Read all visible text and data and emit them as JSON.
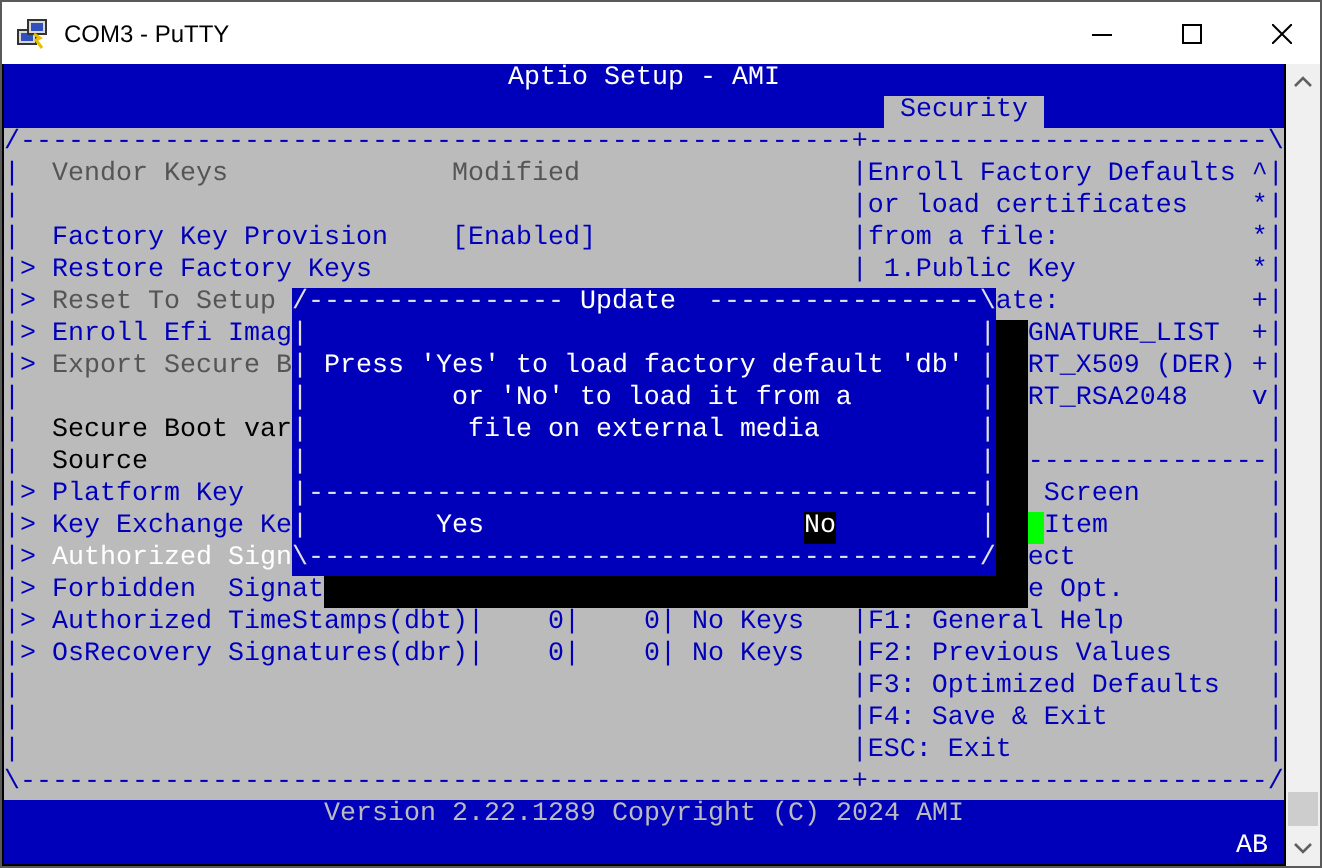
{
  "window": {
    "title": "COM3 - PuTTY"
  },
  "terminal": {
    "lines": [
      {
        "kind": "header",
        "runs": [
          {
            "kind": "title",
            "text": "Aptio Setup - AMI"
          }
        ]
      },
      {
        "kind": "tabs",
        "runs": [
          {
            "kind": "tab",
            "text": "Security",
            "selected": true
          }
        ]
      },
      {
        "kind": "body",
        "runs": [
          {
            "kind": "frame",
            "text": "/----------------------------------------------------+-------------------------\\"
          }
        ]
      },
      {
        "kind": "body",
        "runs": [
          {
            "kind": "frame",
            "text": "|"
          },
          {
            "kind": "muted",
            "text": "  Vendor Keys"
          },
          {
            "kind": "muted",
            "text": "              Modified"
          },
          {
            "kind": "frame",
            "text": "                 |"
          },
          {
            "kind": "label",
            "text": "Enroll Factory Defaults"
          },
          {
            "kind": "frame",
            "text": " ^|"
          }
        ]
      },
      {
        "kind": "body",
        "runs": [
          {
            "kind": "frame",
            "text": "|                                                    |"
          },
          {
            "kind": "label",
            "text": "or load certificates"
          },
          {
            "kind": "frame",
            "text": "    *|"
          }
        ]
      },
      {
        "kind": "body",
        "runs": [
          {
            "kind": "frame",
            "text": "|"
          },
          {
            "kind": "label",
            "text": "  Factory Key Provision"
          },
          {
            "kind": "label",
            "text": "    [Enabled]"
          },
          {
            "kind": "frame",
            "text": "                |"
          },
          {
            "kind": "label",
            "text": "from a file:"
          },
          {
            "kind": "frame",
            "text": "            *|"
          }
        ]
      },
      {
        "kind": "body",
        "runs": [
          {
            "kind": "frame",
            "text": "|>"
          },
          {
            "kind": "label",
            "text": " Restore Factory Keys"
          },
          {
            "kind": "frame",
            "text": "                              |"
          },
          {
            "kind": "label",
            "text": " 1.Public Key"
          },
          {
            "kind": "frame",
            "text": "           *|"
          }
        ]
      },
      {
        "kind": "body",
        "runs": [
          {
            "kind": "frame",
            "text": "|>"
          },
          {
            "kind": "muted",
            "text": " Reset To Setup "
          },
          {
            "kind": "dframe",
            "text": "/---------------- "
          },
          {
            "kind": "dtitle",
            "text": "Update"
          },
          {
            "kind": "dframe",
            "text": "  -----------------\\"
          },
          {
            "kind": "label",
            "text": "ate:"
          },
          {
            "kind": "frame",
            "text": "            +|"
          }
        ]
      },
      {
        "kind": "body",
        "runs": [
          {
            "kind": "frame",
            "text": "|>"
          },
          {
            "kind": "label",
            "text": " Enroll Efi Imag"
          },
          {
            "kind": "dframe",
            "text": "|                                          |"
          },
          {
            "kind": "shadow"
          },
          {
            "kind": "label",
            "text": "GNATURE_LIST"
          },
          {
            "kind": "frame",
            "text": "  +|"
          }
        ]
      },
      {
        "kind": "body",
        "runs": [
          {
            "kind": "frame",
            "text": "|>"
          },
          {
            "kind": "muted",
            "text": " Export Secure B"
          },
          {
            "kind": "dframe",
            "text": "| "
          },
          {
            "kind": "dtext",
            "text": "Press 'Yes' to load factory default 'db'"
          },
          {
            "kind": "dframe",
            "text": " |"
          },
          {
            "kind": "shadow"
          },
          {
            "kind": "label",
            "text": "RT_X509 (DER)"
          },
          {
            "kind": "frame",
            "text": " +|"
          }
        ]
      },
      {
        "kind": "body",
        "runs": [
          {
            "kind": "frame",
            "text": "|                 "
          },
          {
            "kind": "dframe",
            "text": "|         "
          },
          {
            "kind": "dtext",
            "text": "or 'No' to load it from a"
          },
          {
            "kind": "dframe",
            "text": "        |"
          },
          {
            "kind": "shadow"
          },
          {
            "kind": "label",
            "text": "RT_RSA2048"
          },
          {
            "kind": "frame",
            "text": "    v|"
          }
        ]
      },
      {
        "kind": "body",
        "runs": [
          {
            "kind": "frame",
            "text": "|"
          },
          {
            "kind": "plain",
            "text": "  Secure Boot var"
          },
          {
            "kind": "dframe",
            "text": "|          "
          },
          {
            "kind": "dtext",
            "text": "file on external media"
          },
          {
            "kind": "dframe",
            "text": "          |"
          },
          {
            "kind": "shadow"
          },
          {
            "kind": "frame",
            "text": "               |"
          }
        ]
      },
      {
        "kind": "body",
        "runs": [
          {
            "kind": "frame",
            "text": "|"
          },
          {
            "kind": "plain",
            "text": "  Source         "
          },
          {
            "kind": "dframe",
            "text": "|                                          |"
          },
          {
            "kind": "shadow"
          },
          {
            "kind": "frame",
            "text": "---------------|"
          }
        ]
      },
      {
        "kind": "body",
        "runs": [
          {
            "kind": "frame",
            "text": "|>"
          },
          {
            "kind": "label",
            "text": " Platform Key   "
          },
          {
            "kind": "dframe",
            "text": "|------------------------------------------|"
          },
          {
            "kind": "shadow"
          },
          {
            "kind": "label",
            "text": " Screen"
          },
          {
            "kind": "frame",
            "text": "        |"
          }
        ]
      },
      {
        "kind": "body",
        "runs": [
          {
            "kind": "frame",
            "text": "|>"
          },
          {
            "kind": "label",
            "text": " Key Exchange Ke"
          },
          {
            "kind": "dframe",
            "text": "|        "
          },
          {
            "kind": "choice",
            "text": "Yes",
            "selected": false
          },
          {
            "kind": "gap"
          },
          {
            "kind": "choice",
            "text": "No",
            "selected": true
          },
          {
            "kind": "dframe",
            "text": "         |"
          },
          {
            "kind": "shadow"
          },
          {
            "kind": "cursor"
          },
          {
            "kind": "label",
            "text": "Item"
          },
          {
            "kind": "frame",
            "text": "          |"
          }
        ]
      },
      {
        "kind": "body",
        "runs": [
          {
            "kind": "frame",
            "text": "|>"
          },
          {
            "kind": "highlight",
            "text": " Authorized Sign"
          },
          {
            "kind": "dframe",
            "text": "\\------------------------------------------/"
          },
          {
            "kind": "shadow"
          },
          {
            "kind": "label",
            "text": "ect"
          },
          {
            "kind": "frame",
            "text": "            |"
          }
        ]
      },
      {
        "kind": "body",
        "runs": [
          {
            "kind": "frame",
            "text": "|>"
          },
          {
            "kind": "label",
            "text": " Forbidden  Signat"
          },
          {
            "kind": "shadowrow"
          },
          {
            "kind": "label",
            "text": "e Opt."
          },
          {
            "kind": "frame",
            "text": "         |"
          }
        ]
      },
      {
        "kind": "body",
        "runs": [
          {
            "kind": "frame",
            "text": "|>"
          },
          {
            "kind": "label",
            "text": " Authorized TimeStamps(dbt)"
          },
          {
            "kind": "frame",
            "text": "|"
          },
          {
            "kind": "label",
            "text": "    0"
          },
          {
            "kind": "frame",
            "text": "|"
          },
          {
            "kind": "label",
            "text": "    0"
          },
          {
            "kind": "frame",
            "text": "|"
          },
          {
            "kind": "label",
            "text": " No Keys"
          },
          {
            "kind": "frame",
            "text": "   |"
          },
          {
            "kind": "label",
            "text": "F1: General Help"
          },
          {
            "kind": "frame",
            "text": "         |"
          }
        ]
      },
      {
        "kind": "body",
        "runs": [
          {
            "kind": "frame",
            "text": "|>"
          },
          {
            "kind": "label",
            "text": " OsRecovery Signatures(dbr)"
          },
          {
            "kind": "frame",
            "text": "|"
          },
          {
            "kind": "label",
            "text": "    0"
          },
          {
            "kind": "frame",
            "text": "|"
          },
          {
            "kind": "label",
            "text": "    0"
          },
          {
            "kind": "frame",
            "text": "|"
          },
          {
            "kind": "label",
            "text": " No Keys"
          },
          {
            "kind": "frame",
            "text": "   |"
          },
          {
            "kind": "label",
            "text": "F2: Previous Values"
          },
          {
            "kind": "frame",
            "text": "      |"
          }
        ]
      },
      {
        "kind": "body",
        "runs": [
          {
            "kind": "frame",
            "text": "|                                                    |"
          },
          {
            "kind": "label",
            "text": "F3: Optimized Defaults"
          },
          {
            "kind": "frame",
            "text": "   |"
          }
        ]
      },
      {
        "kind": "body",
        "runs": [
          {
            "kind": "frame",
            "text": "|                                                    |"
          },
          {
            "kind": "label",
            "text": "F4: Save & Exit"
          },
          {
            "kind": "frame",
            "text": "          |"
          }
        ]
      },
      {
        "kind": "body",
        "runs": [
          {
            "kind": "frame",
            "text": "|                                                    |"
          },
          {
            "kind": "label",
            "text": "ESC: Exit"
          },
          {
            "kind": "frame",
            "text": "                |"
          }
        ]
      },
      {
        "kind": "body",
        "runs": [
          {
            "kind": "frame",
            "text": "\\----------------------------------------------------+-------------------------/"
          }
        ]
      },
      {
        "kind": "footer",
        "runs": [
          {
            "kind": "footer",
            "text": "Version 2.22.1289 Copyright (C) 2024 AMI"
          }
        ]
      },
      {
        "kind": "status",
        "runs": [
          {
            "kind": "status",
            "text": "AB"
          }
        ]
      }
    ]
  }
}
